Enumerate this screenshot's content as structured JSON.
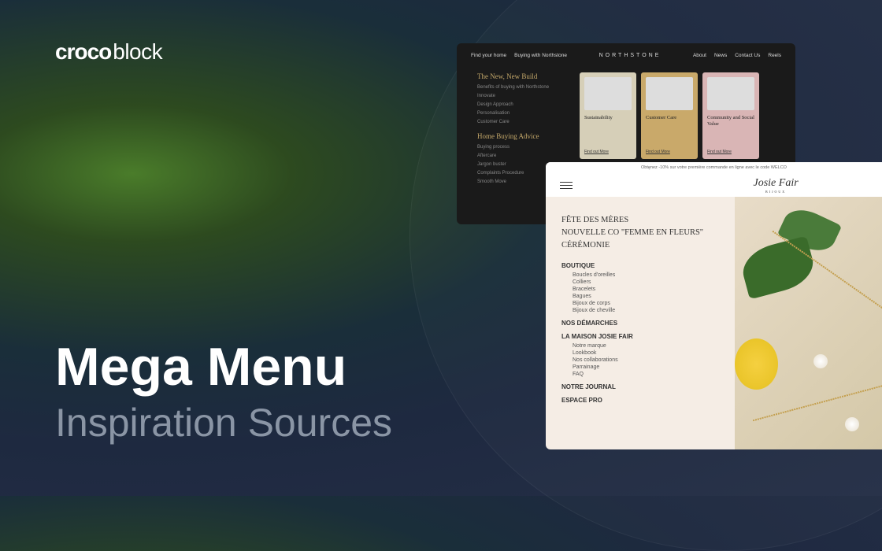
{
  "logo": {
    "part1": "croco",
    "part2": "block"
  },
  "headline": {
    "title": "Mega Menu",
    "subtitle": "Inspiration Sources"
  },
  "northstone": {
    "nav_left": [
      "Find your home",
      "Buying with Northstone"
    ],
    "brand": "NORTHSTONE",
    "nav_right": [
      "About",
      "News",
      "Contact Us",
      "Reels"
    ],
    "section1_title": "The New, New Build",
    "section1_items": [
      "Benefits of buying with Northstone",
      "Innovate",
      "Design Approach",
      "Personalisation",
      "Customer Care"
    ],
    "section2_title": "Home Buying Advice",
    "section2_items": [
      "Buying process",
      "Aftercare",
      "Jargon buster",
      "Complaints Procedure",
      "Smooth Move"
    ],
    "cards": [
      {
        "title": "Sustainability",
        "link": "Find out More"
      },
      {
        "title": "Customer Care",
        "link": "Find out More"
      },
      {
        "title": "Community and Social Value",
        "link": "Find out More"
      }
    ]
  },
  "josie": {
    "promo_bar": "Obtenez -10% sur votre première commande en ligne avec le code WELCO",
    "brand": "Josie Fair",
    "brand_sub": "BIJOUX",
    "promo_lines": [
      "FÊTE DES MÈRES",
      "NOUVELLE CO \"FEMME EN FLEURS\"",
      "CÉRÉMONIE"
    ],
    "boutique_title": "BOUTIQUE",
    "boutique_items": [
      "Boucles d'oreilles",
      "Colliers",
      "Bracelets",
      "Bagues",
      "Bijoux de corps",
      "Bijoux de cheville"
    ],
    "demarches": "NOS DÉMARCHES",
    "maison_title": "LA MAISON JOSIE FAIR",
    "maison_items": [
      "Notre marque",
      "Lookbook",
      "Nos collaborations",
      "Parrainage",
      "FAQ"
    ],
    "journal": "NOTRE JOURNAL",
    "espace": "ESPACE PRO"
  }
}
